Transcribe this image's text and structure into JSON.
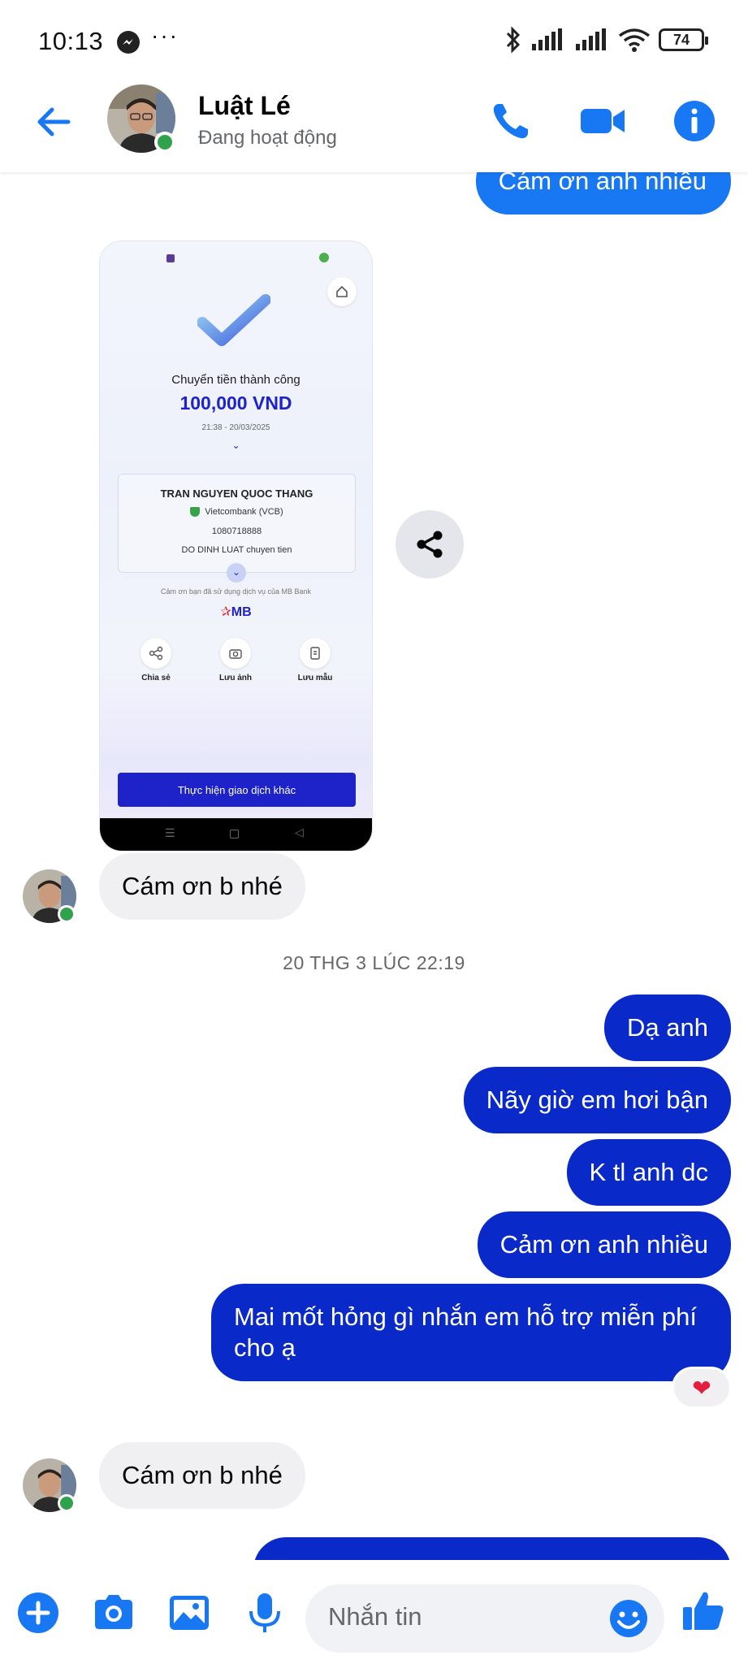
{
  "status_bar": {
    "time": "10:13",
    "more": "···",
    "battery": "74"
  },
  "header": {
    "contact_name": "Luật Lé",
    "contact_status": "Đang hoạt động",
    "icons": [
      "back-arrow-icon",
      "phone-icon",
      "video-camera-icon",
      "info-icon"
    ],
    "accent_color": "#1877f2"
  },
  "messages": {
    "partial_top": "Cám ơn anh nhiều",
    "receipt": {
      "title": "Chuyển tiền thành công",
      "amount": "100,000 VND",
      "datetime": "21:38 - 20/03/2025",
      "recipient_name": "TRAN NGUYEN QUOC THANG",
      "bank": "Vietcombank (VCB)",
      "account": "1080718888",
      "note": "DO DINH LUAT chuyen tien",
      "thanks": "Cảm ơn bạn đã sử dụng dịch vụ của MB Bank",
      "brand": "MB",
      "actions": [
        "Chia sẻ",
        "Lưu ảnh",
        "Lưu mẫu"
      ],
      "cta": "Thực hiện giao dịch khác"
    },
    "them_1": "Cám ơn b nhé",
    "timestamp": "20 THG 3 LÚC 22:19",
    "me_1": "Dạ anh",
    "me_2": "Nãy giờ em hơi bận",
    "me_3": "K tl anh dc",
    "me_4": "Cảm ơn anh nhiều",
    "me_5_line1": "Mai mốt hỏng gì nhắn em hỗ trợ miễn phí",
    "me_5_line2": "cho ạ",
    "reaction": "❤",
    "them_2": "Cám ơn b nhé"
  },
  "composer": {
    "placeholder": "Nhắn tin",
    "icons": [
      "plus-icon",
      "camera-icon",
      "gallery-icon",
      "microphone-icon",
      "emoji-icon",
      "thumbs-up-icon"
    ]
  }
}
